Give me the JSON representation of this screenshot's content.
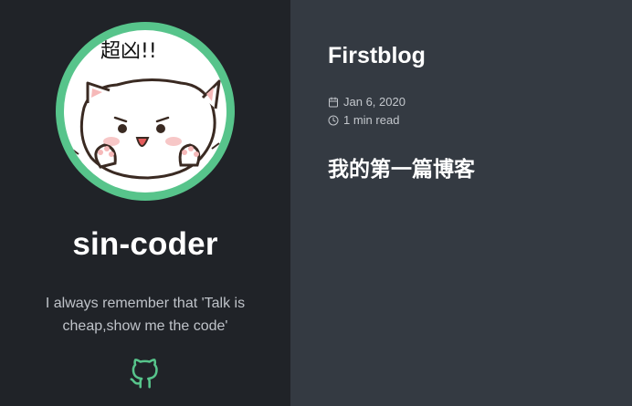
{
  "sidebar": {
    "avatar_icon": "cat-sticker-avatar",
    "avatar_caption": "超凶!!",
    "author_name": "sin-coder",
    "bio": "I always remember that 'Talk is cheap,show me the code'",
    "github_icon": "github-icon"
  },
  "post": {
    "title": "Firstblog",
    "date": "Jan 6, 2020",
    "read_time": "1 min read",
    "content_heading": "我的第一篇博客"
  },
  "colors": {
    "sidebar_bg": "#202328",
    "main_bg": "#343a42",
    "accent": "#57c48b"
  }
}
